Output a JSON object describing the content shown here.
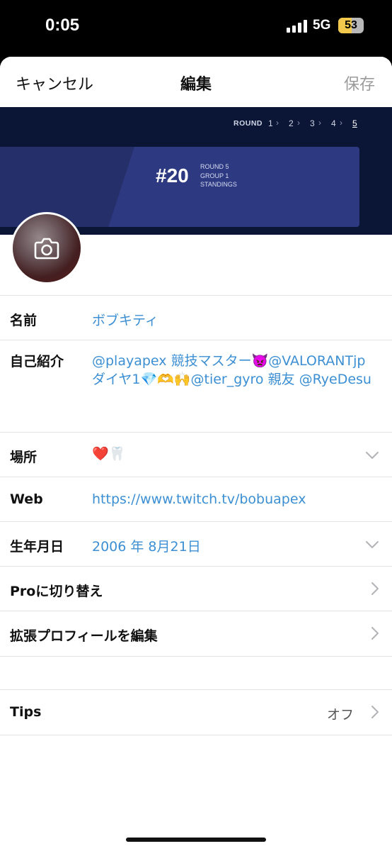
{
  "status": {
    "time": "0:05",
    "network": "5G",
    "battery": "53",
    "battery_level": 0.53
  },
  "nav": {
    "cancel": "キャンセル",
    "title": "編集",
    "save": "保存"
  },
  "banner": {
    "round_label": "ROUND",
    "rounds": [
      "1",
      "2",
      "3",
      "4",
      "5"
    ],
    "active_round": "5",
    "rank": "#20",
    "sub_lines": [
      "ROUND 5",
      "GROUP 1",
      "STANDINGS"
    ]
  },
  "icons": {
    "avatar_camera": "camera-icon",
    "chevron_down": "chevron-down-icon",
    "chevron_right": "chevron-right-icon"
  },
  "profile": {
    "name_label": "名前",
    "name_value": "ボブキティ",
    "bio_label": "自己紹介",
    "bio_value": "@playapex 競技マスター👿@VALORANTjp ダイヤ1💎🫶🙌@tier_gyro 親友 @RyeDesu",
    "location_label": "場所",
    "location_value": "❤️🦷",
    "web_label": "Web",
    "web_value": "https://www.twitch.tv/bobuapex",
    "birthday_label": "生年月日",
    "birthday_value": "2006 年 8月21日",
    "pro_label": "Proに切り替え",
    "extended_label": "拡張プロフィールを編集",
    "tips_label": "Tips",
    "tips_value": "オフ"
  },
  "colors": {
    "accent": "#3c8fd3",
    "banner_bg": "#0b1535",
    "card_bg": "#2d3a82"
  }
}
